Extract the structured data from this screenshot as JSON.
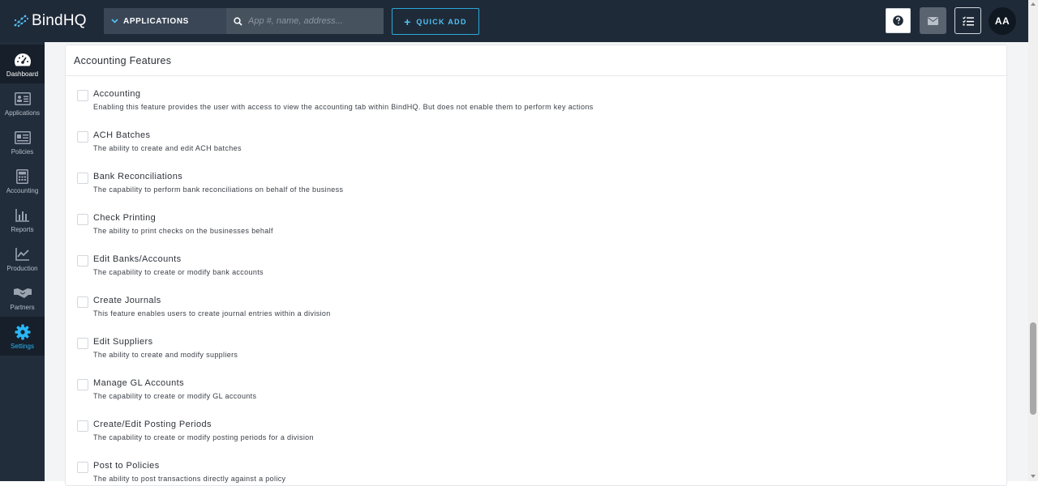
{
  "header": {
    "logo_text": "BindHQ",
    "app_selector_label": "APPLICATIONS",
    "search_placeholder": "App #, name, address...",
    "quick_add_label": "QUICK ADD",
    "avatar_initials": "AA",
    "accent_color": "#29b6f6"
  },
  "sidebar": {
    "items": [
      {
        "label": "Dashboard",
        "icon": "dashboard-gauge-icon"
      },
      {
        "label": "Applications",
        "icon": "id-card-icon"
      },
      {
        "label": "Policies",
        "icon": "policy-card-icon"
      },
      {
        "label": "Accounting",
        "icon": "calculator-icon"
      },
      {
        "label": "Reports",
        "icon": "bar-chart-icon"
      },
      {
        "label": "Production",
        "icon": "line-chart-icon"
      },
      {
        "label": "Partners",
        "icon": "handshake-icon"
      },
      {
        "label": "Settings",
        "icon": "gear-icon"
      }
    ]
  },
  "main": {
    "section_title": "Accounting Features",
    "features": [
      {
        "title": "Accounting",
        "description": "Enabling this feature provides the user with access to view the accounting tab within BindHQ. But does not enable them to perform key actions"
      },
      {
        "title": "ACH Batches",
        "description": "The ability to create and edit ACH batches"
      },
      {
        "title": "Bank Reconciliations",
        "description": "The capability to perform bank reconciliations on behalf of the business"
      },
      {
        "title": "Check Printing",
        "description": "The ability to print checks on the businesses behalf"
      },
      {
        "title": "Edit Banks/Accounts",
        "description": "The capability to create or modify bank accounts"
      },
      {
        "title": "Create Journals",
        "description": "This feature enables users to create journal entries within a division"
      },
      {
        "title": "Edit Suppliers",
        "description": "The ability to create and modify suppliers"
      },
      {
        "title": "Manage GL Accounts",
        "description": "The capability to create or modify GL accounts"
      },
      {
        "title": "Create/Edit Posting Periods",
        "description": "The capability to create or modify posting periods for a division"
      },
      {
        "title": "Post to Policies",
        "description": "The ability to post transactions directly against a policy"
      }
    ]
  }
}
